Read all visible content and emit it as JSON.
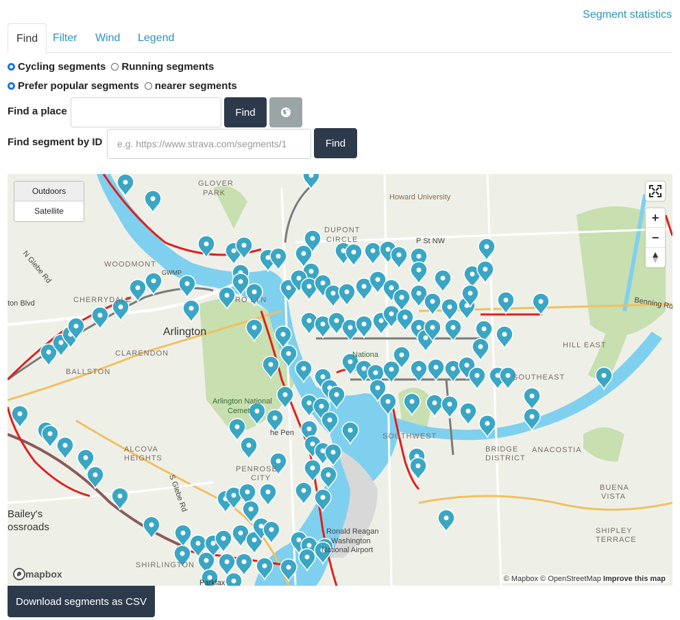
{
  "header": {
    "stats_link": "Segment statistics"
  },
  "tabs": [
    {
      "label": "Find",
      "active": true
    },
    {
      "label": "Filter",
      "active": false
    },
    {
      "label": "Wind",
      "active": false
    },
    {
      "label": "Legend",
      "active": false
    }
  ],
  "activity": {
    "cycling": "Cycling segments",
    "running": "Running segments"
  },
  "preference": {
    "popular": "Prefer popular segments",
    "nearer": "nearer segments"
  },
  "place": {
    "label": "Find a place",
    "value": "",
    "find": "Find"
  },
  "segment_id": {
    "label": "Find segment by ID",
    "placeholder": "e.g. https://www.strava.com/segments/1",
    "find": "Find"
  },
  "map": {
    "layers": {
      "outdoors": "Outdoors",
      "satellite": "Satellite"
    },
    "labels": {
      "arlington": "Arlington",
      "glover": "GLOVER",
      "park": "PARK",
      "howard": "Howard University",
      "dupont": "DUPONT",
      "circle": "CIRCLE",
      "pst": "P St NW",
      "woodmont": "WOODMONT",
      "cherrydale": "CHERRYDALE",
      "clarendon": "CLARENDON",
      "ballston": "BALLSTON",
      "glebe": "N Glebe Rd",
      "benning": "Benning Rd",
      "hilleast": "HILL EAST",
      "southeast": "SOUTHEAST",
      "arlnat": "Arlington National",
      "cem": "Cemet",
      "southwest": "SOUTHWEST",
      "alcova": "ALCOVA",
      "heights": "HEIGHTS",
      "bridge": "BRIDGE",
      "district": "DISTRICT",
      "anacostia": "ANACOSTIA",
      "buena": "BUENA",
      "vista": "VISTA",
      "penrose": "PENROSE",
      "city": "CITY",
      "reagan": "Ronald Reagan",
      "washington": "Washington",
      "airport": "National Airport",
      "shipley": "SHIPLEY",
      "terrace": "TERRACE",
      "shirlington": "SHIRLINGTON",
      "baileys": "Bailey's",
      "crossroads": "ossroads",
      "sglebe": "S Glebe Rd",
      "ton": "ton Blvd",
      "gwmp": "GWMP",
      "parkfax": "Parkfax",
      "national": "Nationa",
      "thepen": "he Pen",
      "rosslyn": "RO LYN"
    },
    "attribution": {
      "mapbox": "© Mapbox",
      "osm": "© OpenStreetMap",
      "improve": "Improve this map"
    },
    "logo": "mapbox"
  },
  "csv_button": "Download segments as CSV",
  "colors": {
    "accent": "#2a93b8",
    "dark_button": "#2d3a4b",
    "marker": "#3aa6c4",
    "river": "#7fd0ee",
    "segment": "#e01e1e"
  }
}
